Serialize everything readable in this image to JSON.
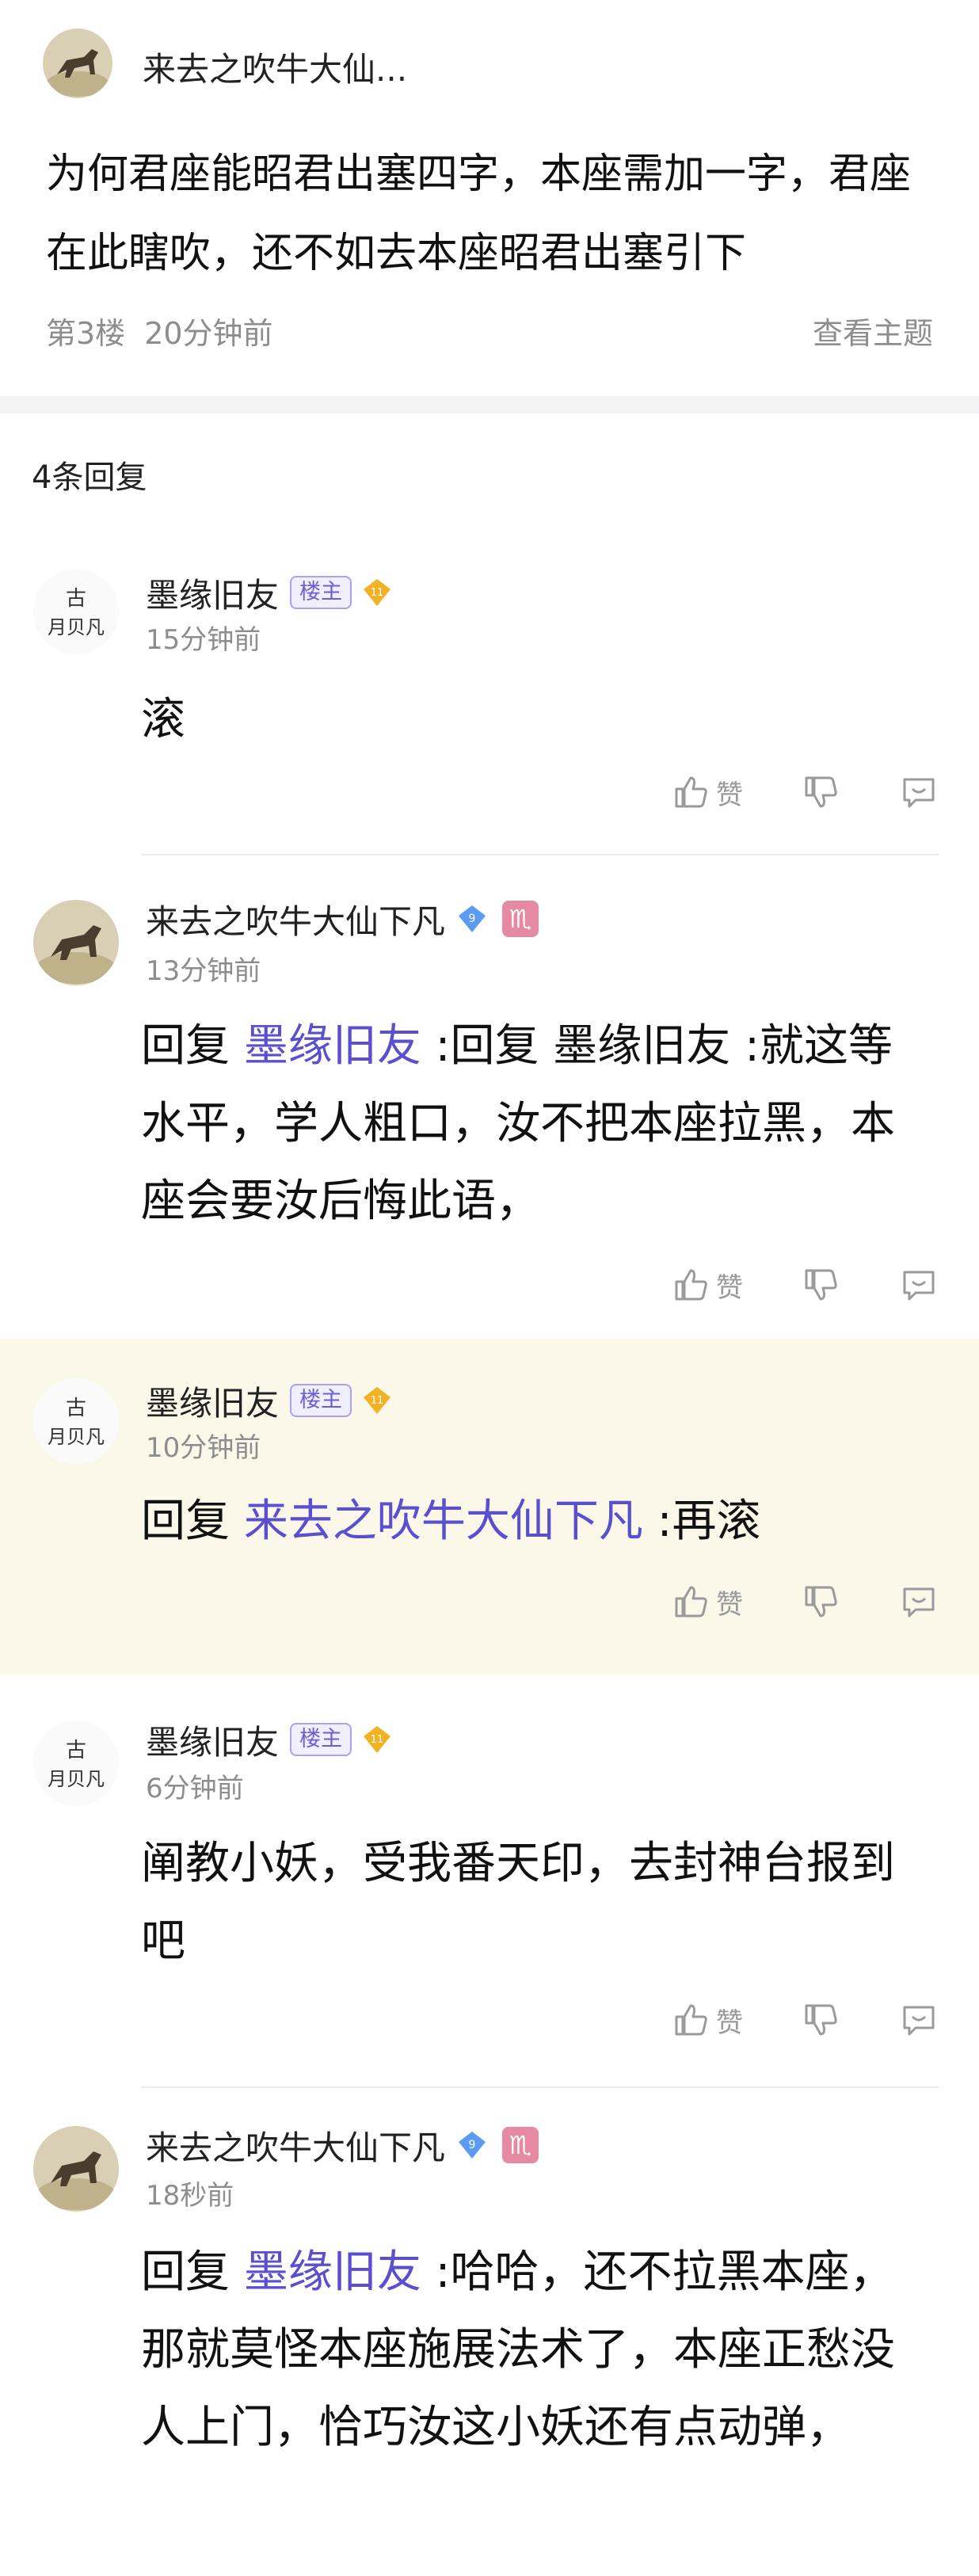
{
  "top_post": {
    "author": "来去之吹牛大仙...",
    "content": "为何君座能昭君出塞四字，本座需加一字，君座在此瞎吹，还不如去本座昭君出塞引下",
    "floor": "第3楼",
    "time": "20分钟前",
    "view_topic": "查看主题"
  },
  "reply_count": "4条回复",
  "replies": [
    {
      "author": "墨缘旧友",
      "host_badge": "楼主",
      "level": "11",
      "time": "15分钟前",
      "prefix": "",
      "mention": "",
      "text": "滚",
      "like_label": "赞"
    },
    {
      "author": "来去之吹牛大仙下凡",
      "level": "9",
      "sign": "♏",
      "time": "13分钟前",
      "prefix": "回复 ",
      "mention": "墨缘旧友",
      "text": " :回复 墨缘旧友 :就这等水平，学人粗口，汝不把本座拉黑，本座会要汝后悔此语，",
      "like_label": "赞"
    },
    {
      "author": "墨缘旧友",
      "host_badge": "楼主",
      "level": "11",
      "time": "10分钟前",
      "prefix": "回复 ",
      "mention": "来去之吹牛大仙下凡",
      "text": " :再滚",
      "like_label": "赞"
    },
    {
      "author": "墨缘旧友",
      "host_badge": "楼主",
      "level": "11",
      "time": "6分钟前",
      "prefix": "",
      "mention": "",
      "text": "阐教小妖，受我番天印，去封神台报到吧",
      "like_label": "赞"
    },
    {
      "author": "来去之吹牛大仙下凡",
      "level": "9",
      "sign": "♏",
      "time": "18秒前",
      "prefix": "回复 ",
      "mention": "墨缘旧友",
      "text": " :哈哈，还不拉黑本座，那就莫怪本座施展法术了，本座正愁没人上门，恰巧汝这小妖还有点动弹，",
      "like_label": "赞"
    }
  ],
  "colors": {
    "mention": "#5a4fcf",
    "highlight_bg": "#fcf8e9",
    "meta_gray": "#8d8d8d",
    "level_gold": "#f2b224",
    "level_blue": "#5b9cf2",
    "scorpio_pink": "#e68aa4"
  },
  "icons": [
    "thumb-up-icon",
    "thumb-down-icon",
    "comment-icon",
    "level-diamond-icon",
    "scorpio-icon"
  ]
}
